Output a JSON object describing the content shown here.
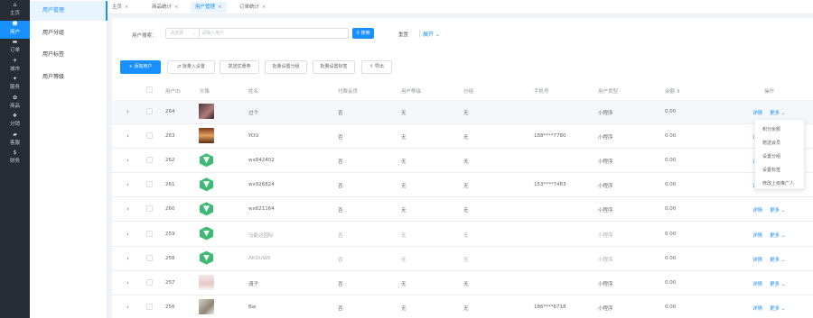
{
  "nav": [
    {
      "label": "主页",
      "icon": "home-icon"
    },
    {
      "label": "用户",
      "icon": "user-icon",
      "active": true
    },
    {
      "label": "订单",
      "icon": "cart-icon"
    },
    {
      "label": "城市",
      "icon": "city-icon"
    },
    {
      "label": "服务",
      "icon": "service-icon"
    },
    {
      "label": "商品",
      "icon": "goods-icon"
    },
    {
      "label": "分销",
      "icon": "share-icon"
    },
    {
      "label": "客服",
      "icon": "chat-icon"
    },
    {
      "label": "财务",
      "icon": "finance-icon"
    }
  ],
  "submenu": [
    {
      "label": "用户管理",
      "active": true
    },
    {
      "label": "用户分组"
    },
    {
      "label": "用户标签"
    },
    {
      "label": "用户等级"
    }
  ],
  "tabs": [
    {
      "label": "主页"
    },
    {
      "label": "商品统计"
    },
    {
      "label": "用户管理",
      "active": true
    },
    {
      "label": "订单统计"
    }
  ],
  "search": {
    "label": "用户搜索：",
    "select_placeholder": "请选择",
    "input_placeholder": "请输入用户",
    "search_button": "搜索",
    "reset": "重置",
    "expand": "展开"
  },
  "toolbar": {
    "add": "+ 添加用户",
    "import": "⇄ 批量入设置",
    "send_coupon": "发送优惠券",
    "set_group": "批量设置分组",
    "set_tag": "批量设置标签",
    "export": "导出"
  },
  "table": {
    "columns": [
      "用户ID",
      "头像",
      "姓名",
      "付费会员",
      "用户等级",
      "分组",
      "手机号",
      "用户类型",
      "余额",
      "操作"
    ],
    "rows": [
      {
        "id": "264",
        "avatar": "photo1",
        "name": "过个",
        "vip": "否",
        "level": "无",
        "group": "无",
        "phone": "",
        "type": "小程序",
        "balance": "0.00",
        "highlight": true
      },
      {
        "id": "263",
        "avatar": "photo2",
        "name": "YOU",
        "vip": "否",
        "level": "无",
        "group": "无",
        "phone": "188****7780",
        "type": "小程序",
        "balance": "0.00"
      },
      {
        "id": "262",
        "avatar": "green",
        "name": "wx842402",
        "vip": "否",
        "level": "无",
        "group": "无",
        "phone": "",
        "type": "小程序",
        "balance": "0.00"
      },
      {
        "id": "261",
        "avatar": "green",
        "name": "wx926824",
        "vip": "否",
        "level": "无",
        "group": "无",
        "phone": "153****7483",
        "type": "小程序",
        "balance": "0.00"
      },
      {
        "id": "260",
        "avatar": "green",
        "name": "wx621164",
        "vip": "否",
        "level": "无",
        "group": "无",
        "phone": "",
        "type": "小程序",
        "balance": "0.00"
      },
      {
        "id": "259",
        "avatar": "green",
        "name": "马能达国际",
        "vip": "否",
        "level": "无",
        "group": "无",
        "phone": "",
        "type": "小程序",
        "balance": "0.00",
        "faded": true
      },
      {
        "id": "258",
        "avatar": "green",
        "name": "AKDUWE",
        "vip": "否",
        "level": "无",
        "group": "无",
        "phone": "",
        "type": "小程序",
        "balance": "0.00",
        "faded": true
      },
      {
        "id": "257",
        "avatar": "person",
        "name": "潇子",
        "vip": "否",
        "level": "无",
        "group": "无",
        "phone": "",
        "type": "小程序",
        "balance": "0.00"
      },
      {
        "id": "256",
        "avatar": "cat",
        "name": "Bai",
        "vip": "否",
        "level": "无",
        "group": "无",
        "phone": "186****6718",
        "type": "小程序",
        "balance": "0.00"
      }
    ],
    "op_detail": "详情",
    "op_more": "更多 ⌄"
  },
  "dropdown": [
    "积分余额",
    "赠送会员",
    "设置分组",
    "设置标签",
    "修改上级推广人"
  ],
  "colors": {
    "accent": "#1890ff",
    "nav_bg": "#282c34"
  }
}
